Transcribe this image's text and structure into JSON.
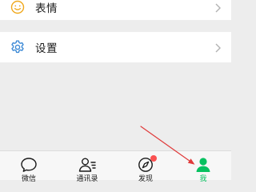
{
  "menu": {
    "emoji_label": "表情",
    "settings_label": "设置"
  },
  "tabbar": {
    "tabs": [
      {
        "label": "微信",
        "icon": "chat-bubble-icon",
        "active": false
      },
      {
        "label": "通讯录",
        "icon": "contacts-icon",
        "active": false
      },
      {
        "label": "发现",
        "icon": "compass-icon",
        "active": false,
        "badge": true
      },
      {
        "label": "我",
        "icon": "person-icon",
        "active": true
      }
    ]
  },
  "colors": {
    "accent": "#07C160",
    "settings_icon": "#3D8AD6",
    "emoji_icon": "#F0A81C",
    "badge": "#FA5151",
    "annotation_arrow": "#E03A3A"
  }
}
